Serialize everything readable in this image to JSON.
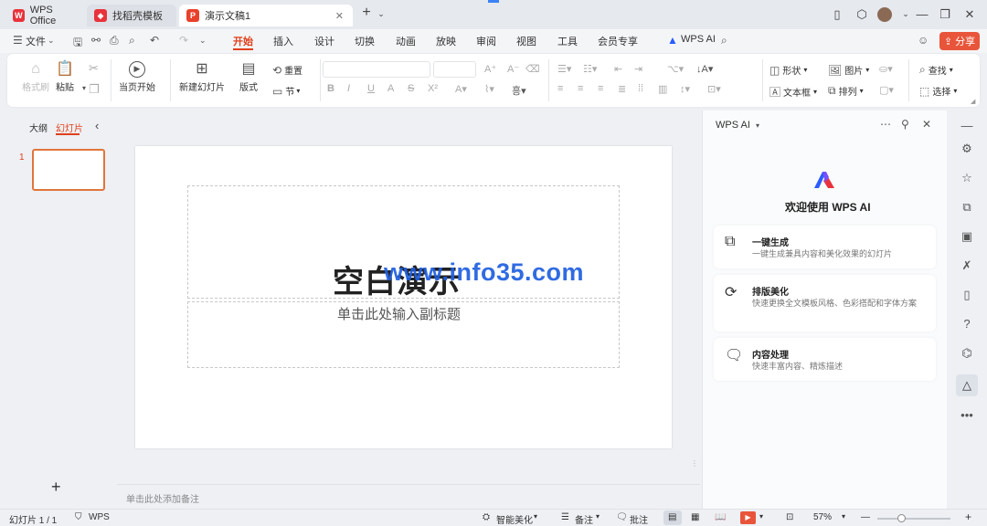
{
  "tabs": [
    {
      "label": "WPS Office"
    },
    {
      "label": "找稻壳模板"
    },
    {
      "label": "演示文稿1"
    }
  ],
  "menu": {
    "file": "文件",
    "items": [
      "开始",
      "插入",
      "设计",
      "切换",
      "动画",
      "放映",
      "审阅",
      "视图",
      "工具",
      "会员专享"
    ],
    "wps_ai": "WPS AI",
    "share": "分享"
  },
  "ribbon": {
    "format_painter": "格式刷",
    "paste": "粘贴",
    "from_current": "当页开始",
    "new_slide": "新建幻灯片",
    "layout": "版式",
    "section": "节",
    "reset": "重置",
    "shape": "形状",
    "image": "图片",
    "find": "查找",
    "textbox": "文本框",
    "arrange": "排列",
    "select": "选择"
  },
  "left_panel": {
    "outline_tab": "大纲",
    "slides_tab": "幻灯片",
    "slide_number": "1",
    "add": "+"
  },
  "slide": {
    "title": "空白演示",
    "subtitle": "单击此处输入副标题",
    "notes_placeholder": "单击此处添加备注"
  },
  "ai_panel": {
    "header": "WPS AI",
    "welcome": "欢迎使用 WPS AI",
    "cards": [
      {
        "title": "一键生成",
        "desc": "一键生成兼具内容和美化效果的幻灯片"
      },
      {
        "title": "排版美化",
        "desc": "快速更换全文模板风格、色彩搭配和字体方案"
      },
      {
        "title": "内容处理",
        "desc": "快速丰富内容、精炼描述"
      }
    ]
  },
  "status": {
    "slide_count": "幻灯片 1 / 1",
    "app": "WPS",
    "smart_beautify": "智能美化",
    "notes": "备注",
    "comments": "批注",
    "zoom": "57%"
  },
  "watermark": "www.info35.com",
  "colors": {
    "accent": "#e0401b",
    "ai_blue": "#2b5cff",
    "wps_red": "#e8323c"
  }
}
